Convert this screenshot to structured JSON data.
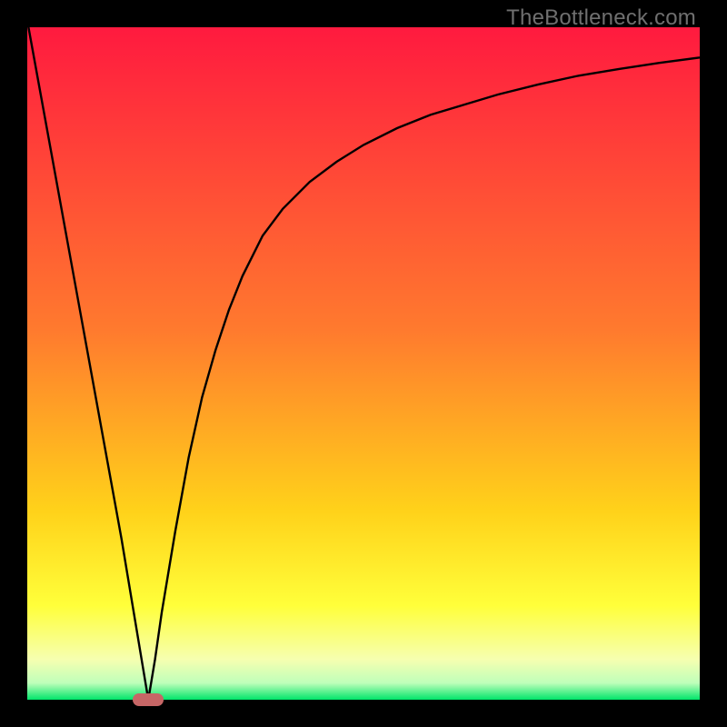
{
  "watermark": "TheBottleneck.com",
  "colors": {
    "gradient": {
      "c0": "#ff1a3f",
      "c1": "#ff7a2e",
      "c2": "#ffd21a",
      "c3": "#ffff3a",
      "c4": "#f6ffb0",
      "c5": "#bfffba",
      "c6": "#00e56a"
    },
    "marker": "#c66666",
    "curve": "#000000"
  },
  "chart_data": {
    "type": "line",
    "title": "",
    "xlabel": "",
    "ylabel": "",
    "xlim": [
      0,
      100
    ],
    "ylim": [
      0,
      100
    ],
    "marker_x": 18,
    "series": [
      {
        "name": "curve",
        "x": [
          0,
          2,
          4,
          6,
          8,
          10,
          12,
          14,
          16,
          17,
          18,
          19,
          20,
          22,
          24,
          26,
          28,
          30,
          32,
          35,
          38,
          42,
          46,
          50,
          55,
          60,
          65,
          70,
          76,
          82,
          88,
          94,
          100
        ],
        "y": [
          101,
          90,
          79,
          68,
          57,
          46,
          35,
          24,
          12,
          6,
          0,
          6,
          13,
          25,
          36,
          45,
          52,
          58,
          63,
          69,
          73,
          77,
          80,
          82.5,
          85,
          87,
          88.5,
          90,
          91.5,
          92.8,
          93.8,
          94.7,
          95.5
        ]
      }
    ]
  }
}
